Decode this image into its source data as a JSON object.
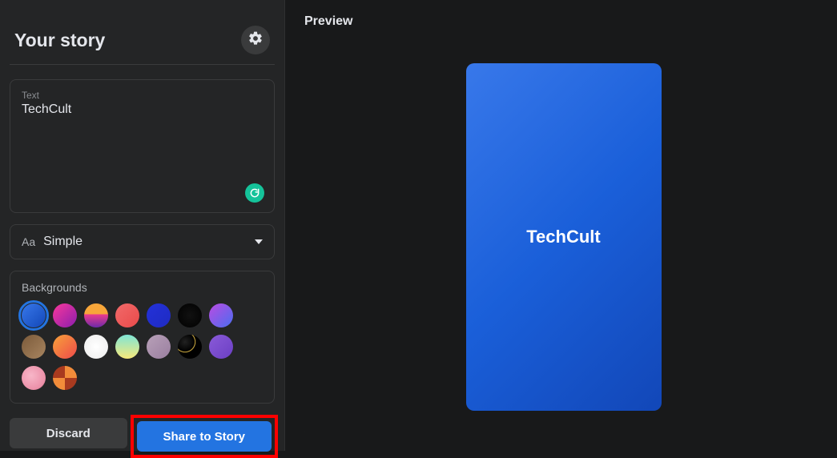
{
  "sidebar": {
    "title": "Your story",
    "text_label": "Text",
    "text_value": "TechCult",
    "font_label": "Simple",
    "backgrounds_label": "Backgrounds",
    "discard_label": "Discard",
    "share_label": "Share to Story"
  },
  "preview": {
    "label": "Preview",
    "story_text": "TechCult"
  },
  "backgrounds": [
    {
      "css": "linear-gradient(135deg,#3878ea,#1247b8)",
      "selected": true
    },
    {
      "css": "linear-gradient(135deg,#f9389b,#8c1eae)"
    },
    {
      "css": "linear-gradient(180deg,#f7a63a 0%,#f7a63a 45%,#ec3b8c 45%,#6d2aa8 100%)"
    },
    {
      "css": "linear-gradient(135deg,#f16a6a,#e94a4a)"
    },
    {
      "css": "linear-gradient(135deg,#2331d9,#1f2bc2)"
    },
    {
      "css": "radial-gradient(circle at 50% 50%, #111 0%, #000 100%)"
    },
    {
      "css": "linear-gradient(135deg,#bb4be2,#4a6df0)"
    },
    {
      "css": "linear-gradient(135deg,#7b5a3a,#a88560)"
    },
    {
      "css": "linear-gradient(135deg,#f7a23a,#ef4a4a)"
    },
    {
      "css": "radial-gradient(circle at 50% 50%,#fff 0%,#f2f2f2 70%,#eaeaea 100%)"
    },
    {
      "css": "linear-gradient(180deg,#7fe5d6 0%,#f7e97a 100%)"
    },
    {
      "css": "linear-gradient(135deg,#b8a0b8,#9a7fa0)"
    },
    {
      "css": "radial-gradient(circle at 30% 30%,#222 0%,#000 40%,#f2c94c 42%,#000 46%)"
    },
    {
      "css": "linear-gradient(135deg,#8a5ad8,#6b3fc4)"
    },
    {
      "css": "radial-gradient(circle at 40% 40%,#f7b6c8 0%,#ec8fa8 70%,#5b1f2e 100%)"
    },
    {
      "css": "conic-gradient(#f28c3a 0 25%,#a83a1f 25% 50%,#f28c3a 50% 75%,#a83a1f 75% 100%)"
    }
  ]
}
